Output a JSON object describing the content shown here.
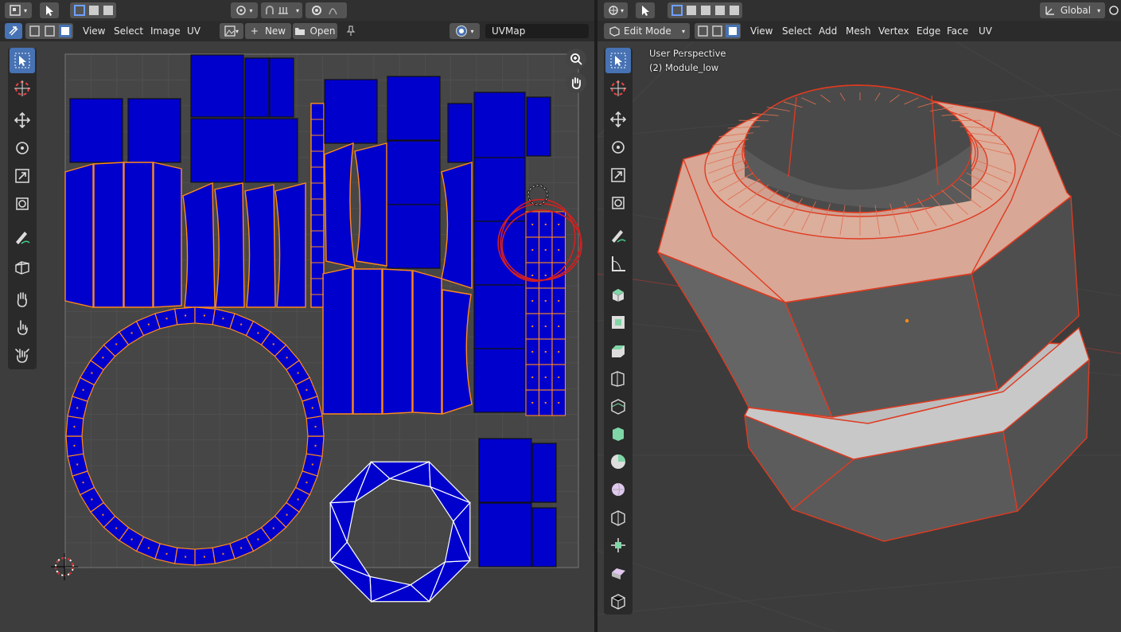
{
  "uv_editor": {
    "header_menus": [
      "View",
      "Select",
      "Image",
      "UV"
    ],
    "new_label": "New",
    "open_label": "Open",
    "uvmap_name": "UVMap"
  },
  "viewport": {
    "mode_label": "Edit Mode",
    "header_menus": [
      "View",
      "Select",
      "Add",
      "Mesh",
      "Vertex",
      "Edge",
      "Face",
      "UV"
    ],
    "orientation_label": "Global",
    "overlay_title": "User Perspective",
    "overlay_object": "(2) Module_low"
  },
  "colors": {
    "uv_face": "#0000cc",
    "uv_edge_selected": "#ff8a1a",
    "selection_outline": "#ff5a1a",
    "annotation": "#d42020",
    "active_tool": "#4772b3"
  },
  "icons": {
    "uv_toolbar": [
      "select-box-icon",
      "cursor-icon",
      "move-icon",
      "rotate-icon",
      "scale-icon",
      "transform-icon",
      "annotate-icon",
      "rip-icon",
      "grab-icon",
      "relax-icon",
      "pinch-icon"
    ],
    "viewport_toolbar": [
      "select-box-icon",
      "cursor-icon",
      "move-icon",
      "rotate-icon",
      "scale-icon",
      "transform-icon",
      "annotate-icon",
      "measure-icon",
      "add-cube-icon",
      "extrude-icon",
      "inset-icon",
      "bevel-icon",
      "loop-cut-icon",
      "knife-icon",
      "poly-build-icon",
      "spin-icon",
      "smooth-icon",
      "edge-slide-icon",
      "shrink-fatten-icon",
      "shear-icon",
      "rip-region-icon"
    ]
  }
}
